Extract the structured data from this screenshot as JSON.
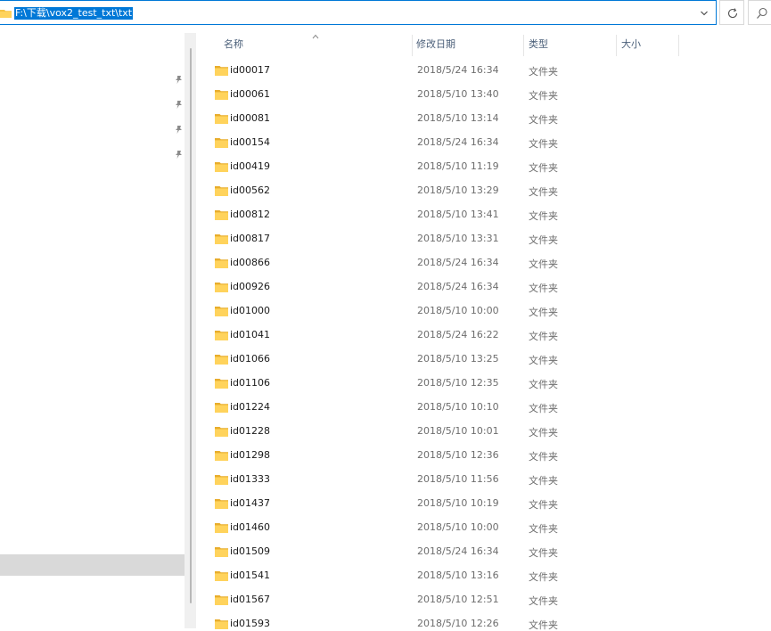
{
  "address_bar": {
    "path": "F:\\下载\\vox2_test_txt\\txt"
  },
  "icons": {
    "folder": "folder-icon",
    "chevron": "chevron-down-icon",
    "refresh": "refresh-icon",
    "search": "search-icon",
    "pin": "pin-icon",
    "sort": "sort-ascending-icon"
  },
  "colors": {
    "accent": "#0078d7",
    "folder": "#f5c242",
    "header_text": "#4c607a"
  },
  "columns": {
    "name": "名称",
    "date": "修改日期",
    "type": "类型",
    "size": "大小"
  },
  "files": [
    {
      "name": "id00017",
      "date": "2018/5/24 16:34",
      "type": "文件夹"
    },
    {
      "name": "id00061",
      "date": "2018/5/10 13:40",
      "type": "文件夹"
    },
    {
      "name": "id00081",
      "date": "2018/5/10 13:14",
      "type": "文件夹"
    },
    {
      "name": "id00154",
      "date": "2018/5/24 16:34",
      "type": "文件夹"
    },
    {
      "name": "id00419",
      "date": "2018/5/10 11:19",
      "type": "文件夹"
    },
    {
      "name": "id00562",
      "date": "2018/5/10 13:29",
      "type": "文件夹"
    },
    {
      "name": "id00812",
      "date": "2018/5/10 13:41",
      "type": "文件夹"
    },
    {
      "name": "id00817",
      "date": "2018/5/10 13:31",
      "type": "文件夹"
    },
    {
      "name": "id00866",
      "date": "2018/5/24 16:34",
      "type": "文件夹"
    },
    {
      "name": "id00926",
      "date": "2018/5/24 16:34",
      "type": "文件夹"
    },
    {
      "name": "id01000",
      "date": "2018/5/10 10:00",
      "type": "文件夹"
    },
    {
      "name": "id01041",
      "date": "2018/5/24 16:22",
      "type": "文件夹"
    },
    {
      "name": "id01066",
      "date": "2018/5/10 13:25",
      "type": "文件夹"
    },
    {
      "name": "id01106",
      "date": "2018/5/10 12:35",
      "type": "文件夹"
    },
    {
      "name": "id01224",
      "date": "2018/5/10 10:10",
      "type": "文件夹"
    },
    {
      "name": "id01228",
      "date": "2018/5/10 10:01",
      "type": "文件夹"
    },
    {
      "name": "id01298",
      "date": "2018/5/10 12:36",
      "type": "文件夹"
    },
    {
      "name": "id01333",
      "date": "2018/5/10 11:56",
      "type": "文件夹"
    },
    {
      "name": "id01437",
      "date": "2018/5/10 10:19",
      "type": "文件夹"
    },
    {
      "name": "id01460",
      "date": "2018/5/10 10:00",
      "type": "文件夹"
    },
    {
      "name": "id01509",
      "date": "2018/5/24 16:34",
      "type": "文件夹"
    },
    {
      "name": "id01541",
      "date": "2018/5/10 13:16",
      "type": "文件夹"
    },
    {
      "name": "id01567",
      "date": "2018/5/10 12:51",
      "type": "文件夹"
    },
    {
      "name": "id01593",
      "date": "2018/5/10 12:26",
      "type": "文件夹"
    }
  ]
}
